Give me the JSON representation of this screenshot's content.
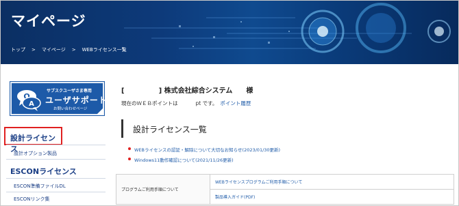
{
  "banner": {
    "title": "マイページ"
  },
  "breadcrumb": {
    "items": [
      "トップ",
      "マイページ",
      "WEBライセンス一覧"
    ],
    "separator": ">"
  },
  "sidebar": {
    "support": {
      "top": "サブスクユーザさま専用",
      "main": "ユーザサポート",
      "sub": "お問い合わせページ"
    },
    "sections": [
      {
        "heading": "設計ライセンス",
        "items": [
          "設計オプション製品"
        ]
      },
      {
        "heading": "ESCONライセンス",
        "items": [
          "ESCON準備ファイルDL",
          "ESCONリンク集"
        ]
      }
    ]
  },
  "main": {
    "company": "[　　　　　] 株式会社綜合システム　　様",
    "points_prefix": "現在のＷＥＢポイントは",
    "points_suffix": "pt です。",
    "points_link": "ポイント履歴",
    "section_title": "設計ライセンス一覧",
    "notices": [
      "WEBライセンスの認証・解除について大切なお知らせ(2023/01/30更新)",
      "Windows11動作確認について(2021/11/26更新)"
    ],
    "table": {
      "label": "プログラムご利用手順について",
      "links": [
        "WEBライセンスプログラムご利用手順について",
        "製品導入ガイド(PDF)"
      ]
    }
  },
  "colors": {
    "accent_blue": "#1d5aa8",
    "heading_navy": "#1b3f86",
    "highlight_red": "#e02020",
    "banner_dark": "#0b2f63"
  }
}
